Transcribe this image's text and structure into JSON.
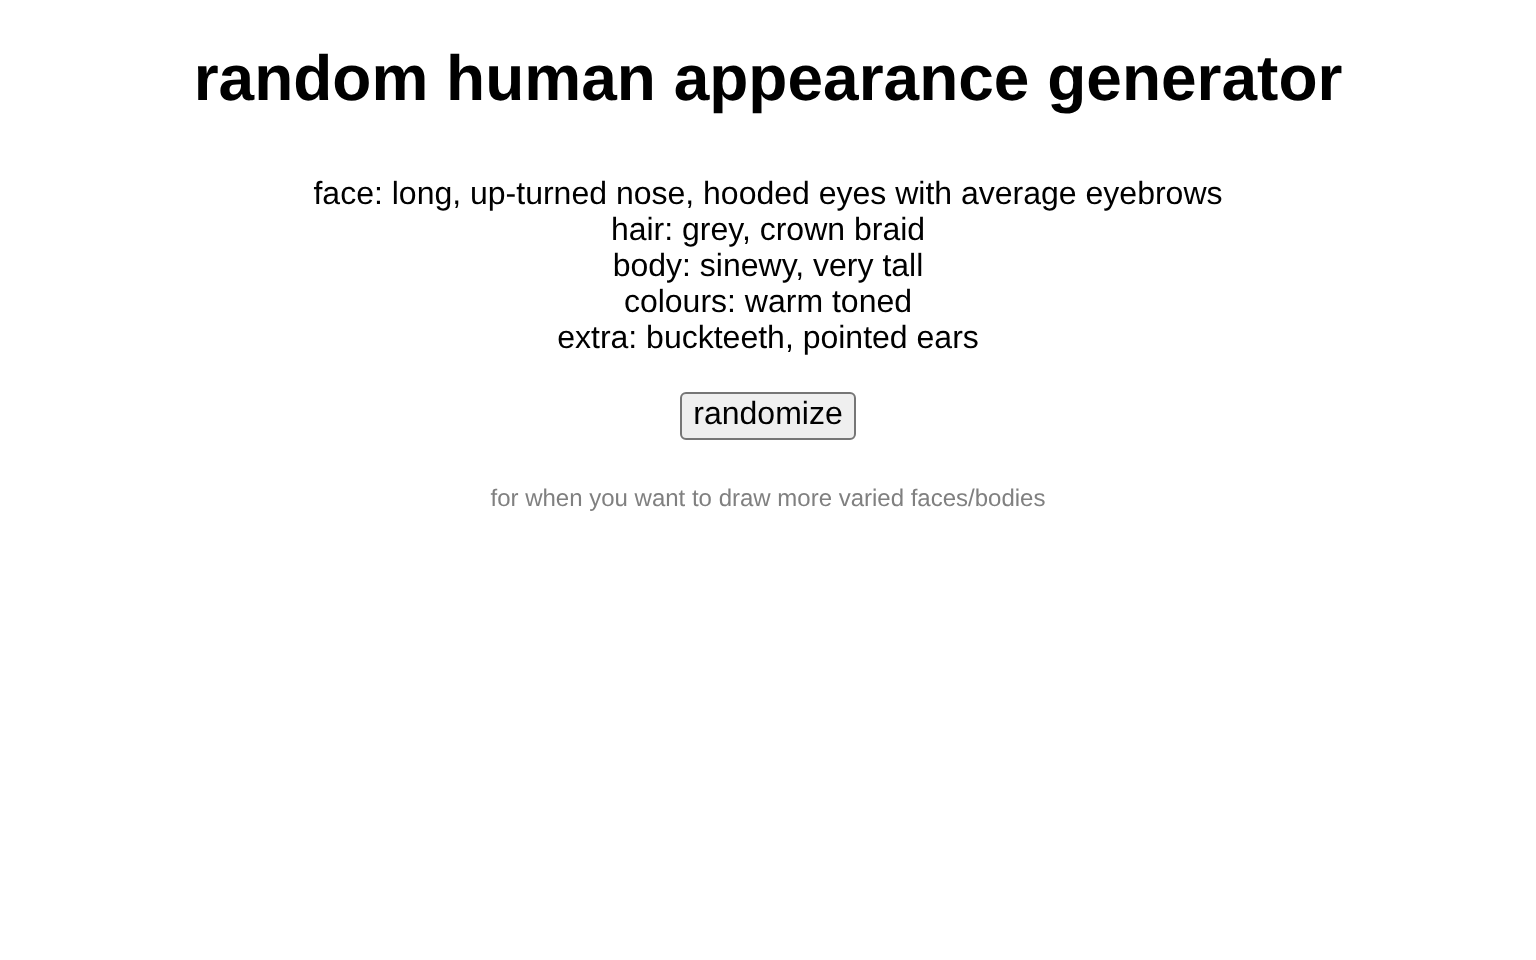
{
  "title": "random human appearance generator",
  "traits": [
    "face: long, up-turned nose, hooded eyes with average eyebrows",
    "hair: grey, crown braid",
    "body: sinewy, very tall",
    "colours: warm toned",
    "extra: buckteeth, pointed ears"
  ],
  "button": "randomize",
  "footer": "for when you want to draw more varied faces/bodies"
}
